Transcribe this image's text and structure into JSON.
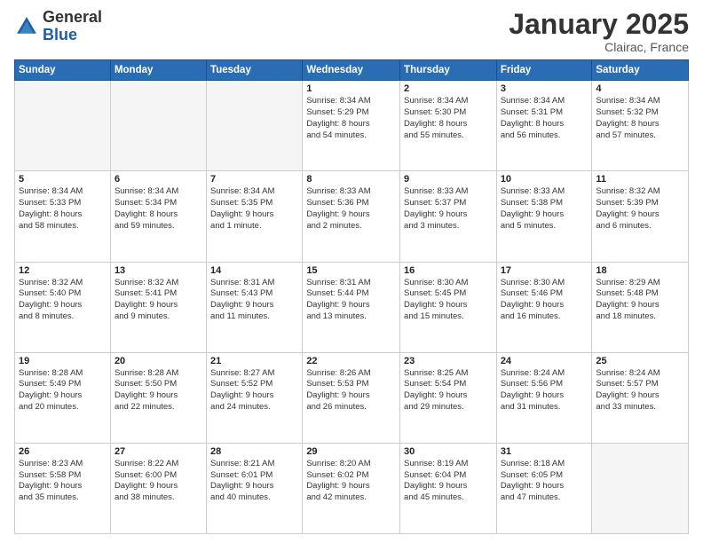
{
  "header": {
    "logo_general": "General",
    "logo_blue": "Blue",
    "month_title": "January 2025",
    "location": "Clairac, France"
  },
  "weekdays": [
    "Sunday",
    "Monday",
    "Tuesday",
    "Wednesday",
    "Thursday",
    "Friday",
    "Saturday"
  ],
  "weeks": [
    [
      {
        "day": "",
        "text": ""
      },
      {
        "day": "",
        "text": ""
      },
      {
        "day": "",
        "text": ""
      },
      {
        "day": "1",
        "text": "Sunrise: 8:34 AM\nSunset: 5:29 PM\nDaylight: 8 hours\nand 54 minutes."
      },
      {
        "day": "2",
        "text": "Sunrise: 8:34 AM\nSunset: 5:30 PM\nDaylight: 8 hours\nand 55 minutes."
      },
      {
        "day": "3",
        "text": "Sunrise: 8:34 AM\nSunset: 5:31 PM\nDaylight: 8 hours\nand 56 minutes."
      },
      {
        "day": "4",
        "text": "Sunrise: 8:34 AM\nSunset: 5:32 PM\nDaylight: 8 hours\nand 57 minutes."
      }
    ],
    [
      {
        "day": "5",
        "text": "Sunrise: 8:34 AM\nSunset: 5:33 PM\nDaylight: 8 hours\nand 58 minutes."
      },
      {
        "day": "6",
        "text": "Sunrise: 8:34 AM\nSunset: 5:34 PM\nDaylight: 8 hours\nand 59 minutes."
      },
      {
        "day": "7",
        "text": "Sunrise: 8:34 AM\nSunset: 5:35 PM\nDaylight: 9 hours\nand 1 minute."
      },
      {
        "day": "8",
        "text": "Sunrise: 8:33 AM\nSunset: 5:36 PM\nDaylight: 9 hours\nand 2 minutes."
      },
      {
        "day": "9",
        "text": "Sunrise: 8:33 AM\nSunset: 5:37 PM\nDaylight: 9 hours\nand 3 minutes."
      },
      {
        "day": "10",
        "text": "Sunrise: 8:33 AM\nSunset: 5:38 PM\nDaylight: 9 hours\nand 5 minutes."
      },
      {
        "day": "11",
        "text": "Sunrise: 8:32 AM\nSunset: 5:39 PM\nDaylight: 9 hours\nand 6 minutes."
      }
    ],
    [
      {
        "day": "12",
        "text": "Sunrise: 8:32 AM\nSunset: 5:40 PM\nDaylight: 9 hours\nand 8 minutes."
      },
      {
        "day": "13",
        "text": "Sunrise: 8:32 AM\nSunset: 5:41 PM\nDaylight: 9 hours\nand 9 minutes."
      },
      {
        "day": "14",
        "text": "Sunrise: 8:31 AM\nSunset: 5:43 PM\nDaylight: 9 hours\nand 11 minutes."
      },
      {
        "day": "15",
        "text": "Sunrise: 8:31 AM\nSunset: 5:44 PM\nDaylight: 9 hours\nand 13 minutes."
      },
      {
        "day": "16",
        "text": "Sunrise: 8:30 AM\nSunset: 5:45 PM\nDaylight: 9 hours\nand 15 minutes."
      },
      {
        "day": "17",
        "text": "Sunrise: 8:30 AM\nSunset: 5:46 PM\nDaylight: 9 hours\nand 16 minutes."
      },
      {
        "day": "18",
        "text": "Sunrise: 8:29 AM\nSunset: 5:48 PM\nDaylight: 9 hours\nand 18 minutes."
      }
    ],
    [
      {
        "day": "19",
        "text": "Sunrise: 8:28 AM\nSunset: 5:49 PM\nDaylight: 9 hours\nand 20 minutes."
      },
      {
        "day": "20",
        "text": "Sunrise: 8:28 AM\nSunset: 5:50 PM\nDaylight: 9 hours\nand 22 minutes."
      },
      {
        "day": "21",
        "text": "Sunrise: 8:27 AM\nSunset: 5:52 PM\nDaylight: 9 hours\nand 24 minutes."
      },
      {
        "day": "22",
        "text": "Sunrise: 8:26 AM\nSunset: 5:53 PM\nDaylight: 9 hours\nand 26 minutes."
      },
      {
        "day": "23",
        "text": "Sunrise: 8:25 AM\nSunset: 5:54 PM\nDaylight: 9 hours\nand 29 minutes."
      },
      {
        "day": "24",
        "text": "Sunrise: 8:24 AM\nSunset: 5:56 PM\nDaylight: 9 hours\nand 31 minutes."
      },
      {
        "day": "25",
        "text": "Sunrise: 8:24 AM\nSunset: 5:57 PM\nDaylight: 9 hours\nand 33 minutes."
      }
    ],
    [
      {
        "day": "26",
        "text": "Sunrise: 8:23 AM\nSunset: 5:58 PM\nDaylight: 9 hours\nand 35 minutes."
      },
      {
        "day": "27",
        "text": "Sunrise: 8:22 AM\nSunset: 6:00 PM\nDaylight: 9 hours\nand 38 minutes."
      },
      {
        "day": "28",
        "text": "Sunrise: 8:21 AM\nSunset: 6:01 PM\nDaylight: 9 hours\nand 40 minutes."
      },
      {
        "day": "29",
        "text": "Sunrise: 8:20 AM\nSunset: 6:02 PM\nDaylight: 9 hours\nand 42 minutes."
      },
      {
        "day": "30",
        "text": "Sunrise: 8:19 AM\nSunset: 6:04 PM\nDaylight: 9 hours\nand 45 minutes."
      },
      {
        "day": "31",
        "text": "Sunrise: 8:18 AM\nSunset: 6:05 PM\nDaylight: 9 hours\nand 47 minutes."
      },
      {
        "day": "",
        "text": ""
      }
    ]
  ]
}
